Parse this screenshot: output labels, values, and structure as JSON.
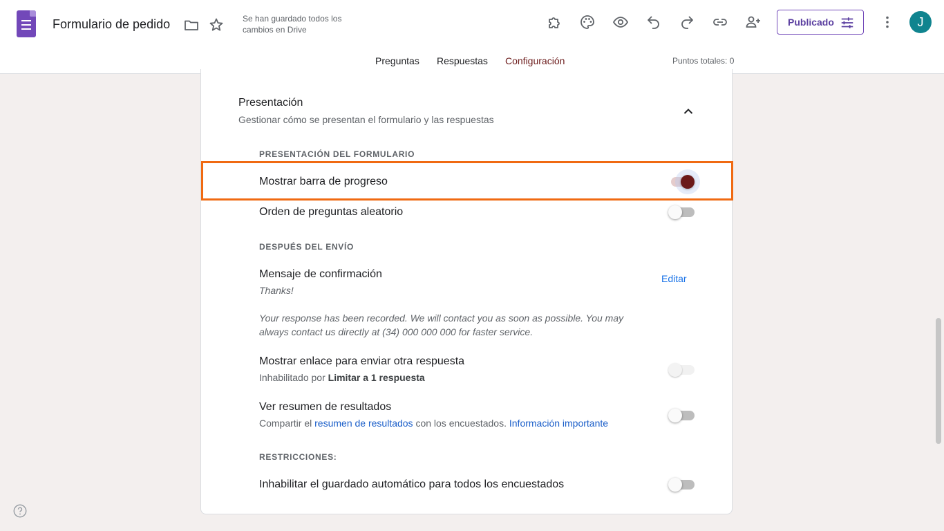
{
  "header": {
    "title": "Formulario de pedido",
    "saved_status": "Se han guardado todos los cambios en Drive",
    "publish_label": "Publicado",
    "avatar_initial": "J",
    "icons": [
      "forms-logo-icon",
      "folder-icon",
      "star-icon",
      "addon-puzzle-icon",
      "palette-icon",
      "preview-eye-icon",
      "undo-icon",
      "redo-icon",
      "link-icon",
      "add-collaborator-icon",
      "tune-icon",
      "more-vert-icon"
    ],
    "brand_color": "#7248b9"
  },
  "tabs": [
    {
      "label": "Preguntas",
      "active": false
    },
    {
      "label": "Respuestas",
      "active": false
    },
    {
      "label": "Configuración",
      "active": true
    }
  ],
  "points_total": "Puntos totales: 0",
  "section": {
    "title": "Presentación",
    "subtitle": "Gestionar cómo se presentan el formulario y las respuestas"
  },
  "groups": {
    "form_presentation": "PRESENTACIÓN DEL FORMULARIO",
    "after_submit": "DESPUÉS DEL ENVÍO",
    "restrictions": "RESTRICCIONES:"
  },
  "settings": {
    "progress_bar": {
      "label": "Mostrar barra de progreso",
      "on": true
    },
    "shuffle": {
      "label": "Orden de preguntas aleatorio",
      "on": false
    },
    "confirmation": {
      "label": "Mensaje de confirmación",
      "edit": "Editar",
      "message_title": "Thanks!",
      "message_body": "Your response has been recorded. We will contact you as soon as possible. You may always contact us directly at (34) 000 000 000 for faster service."
    },
    "another_response": {
      "label": "Mostrar enlace para enviar otra respuesta",
      "sub_prefix": "Inhabilitado por ",
      "sub_bold": "Limitar a 1 respuesta",
      "on": false,
      "disabled": true
    },
    "summary": {
      "label": "Ver resumen de resultados",
      "sub_prefix": "Compartir el ",
      "sub_link": "resumen de resultados",
      "sub_middle": " con los encuestados. ",
      "sub_link2": "Información importante",
      "on": false
    },
    "autosave": {
      "label": "Inhabilitar el guardado automático para todos los encuestados",
      "on": false
    }
  },
  "accent_color": "#6b1a1a",
  "highlight_color": "#f06a12"
}
